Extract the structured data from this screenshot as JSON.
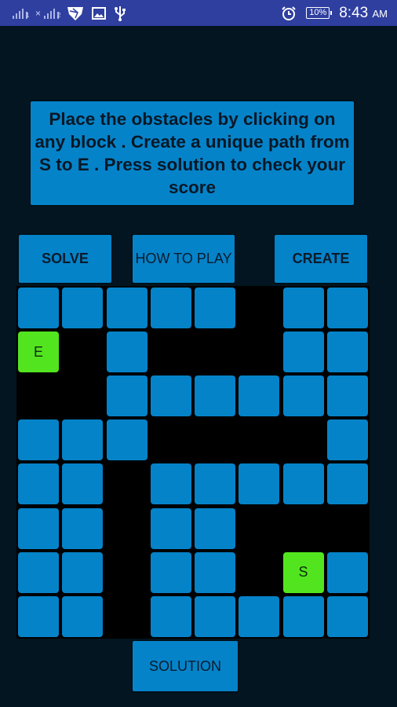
{
  "status_bar": {
    "sim1_label": "1",
    "sim2_label": "2",
    "sim2_prefix": "×",
    "icons": [
      "signal-sim1-icon",
      "signal-sim2-icon",
      "shield-icon",
      "image-icon",
      "usb-icon",
      "alarm-icon",
      "battery-icon"
    ],
    "battery": "10%",
    "time": "8:43",
    "ampm": "AM"
  },
  "instructions": "Place the obstacles by clicking on any block . Create a unique path from S to E . Press solution to check your score",
  "buttons": {
    "solve": "SOLVE",
    "how_to_play": "HOW TO PLAY",
    "create": "CREATE",
    "solution": "SOLUTION"
  },
  "colors": {
    "block": "#0583c9",
    "obstacle": "#000000",
    "endpoint": "#52e51f",
    "background": "#021520",
    "status_bar": "#2f3fa0"
  },
  "grid": {
    "rows": 8,
    "cols": 8,
    "legend": {
      "B": "block",
      "X": "obstacle",
      "S": "start",
      "E": "end"
    },
    "cells": [
      [
        "B",
        "B",
        "B",
        "B",
        "B",
        "X",
        "B",
        "B"
      ],
      [
        "E",
        "X",
        "B",
        "X",
        "X",
        "X",
        "B",
        "B"
      ],
      [
        "X",
        "X",
        "B",
        "B",
        "B",
        "B",
        "B",
        "B"
      ],
      [
        "B",
        "B",
        "B",
        "X",
        "X",
        "X",
        "X",
        "B"
      ],
      [
        "B",
        "B",
        "X",
        "B",
        "B",
        "B",
        "B",
        "B"
      ],
      [
        "B",
        "B",
        "X",
        "B",
        "B",
        "X",
        "X",
        "X"
      ],
      [
        "B",
        "B",
        "X",
        "B",
        "B",
        "X",
        "S",
        "B"
      ],
      [
        "B",
        "B",
        "X",
        "B",
        "B",
        "B",
        "B",
        "B"
      ]
    ],
    "start_label": "S",
    "end_label": "E"
  }
}
